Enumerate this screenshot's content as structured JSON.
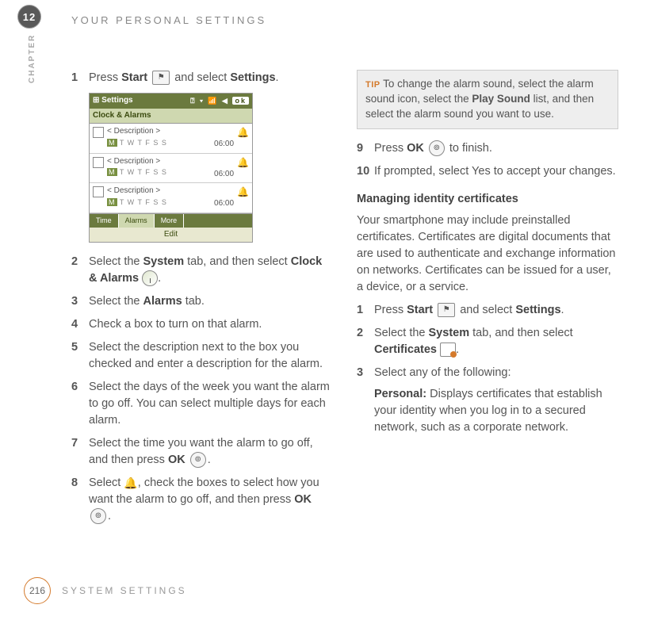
{
  "chapter_number": "12",
  "chapter_label": "CHAPTER",
  "section_title": "YOUR PERSONAL SETTINGS",
  "footer_page": "216",
  "footer_label": "SYSTEM SETTINGS",
  "left": {
    "step1_pre": "Press ",
    "step1_b1": "Start",
    "step1_mid": " and select ",
    "step1_b2": "Settings",
    "step1_post": ".",
    "screenshot": {
      "title": "Settings",
      "ok": "ok",
      "subbar": "Clock & Alarms",
      "desc": "< Description >",
      "days_on": "M",
      "days_rest": "T W T F S S",
      "time": "06:00",
      "tab_time": "Time",
      "tab_alarms": "Alarms",
      "tab_more": "More",
      "bottom": "Edit"
    },
    "step2_pre": "Select the ",
    "step2_b1": "System",
    "step2_mid": " tab, and then select ",
    "step2_b2": "Clock & Alarms",
    "step2_post": ".",
    "step3_pre": "Select the ",
    "step3_b": "Alarms",
    "step3_post": " tab.",
    "step4": "Check a box to turn on that alarm.",
    "step5": "Select the description next to the box you checked and enter a description for the alarm.",
    "step6": "Select the days of the week you want the alarm to go off. You can select multiple days for each alarm.",
    "step7_pre": "Select the time you want the alarm to go off, and then press ",
    "step7_b": "OK",
    "step7_post": ".",
    "step8_pre": "Select ",
    "step8_mid": ", check the boxes to select how you want the alarm to go off, and then press ",
    "step8_b": "OK",
    "step8_post": "."
  },
  "right": {
    "tip_label": "TIP",
    "tip_pre": " To change the alarm sound, select the alarm sound icon, select the ",
    "tip_b": "Play Sound",
    "tip_post": " list, and then select the alarm sound you want to use.",
    "step9_pre": "Press ",
    "step9_b": "OK",
    "step9_post": " to finish.",
    "step10": "If prompted, select Yes to accept your changes.",
    "subhead": "Managing identity certificates",
    "para": "Your smartphone may include preinstalled certificates. Certificates are digital documents that are used to authenticate and exchange information on networks. Certificates can be issued for a user, a device, or a service.",
    "c_step1_pre": "Press ",
    "c_step1_b1": "Start",
    "c_step1_mid": " and select ",
    "c_step1_b2": "Settings",
    "c_step1_post": ".",
    "c_step2_pre": "Select the ",
    "c_step2_b1": "System",
    "c_step2_mid": " tab, and then select ",
    "c_step2_b2": "Certificates",
    "c_step2_post": ".",
    "c_step3": "Select any of the following:",
    "c_personal_b": "Personal:",
    "c_personal_txt": " Displays certificates that establish your identity when you log in to a secured network, such as a corporate network."
  },
  "nums": {
    "n1": "1",
    "n2": "2",
    "n3": "3",
    "n4": "4",
    "n5": "5",
    "n6": "6",
    "n7": "7",
    "n8": "8",
    "n9": "9",
    "n10": "10"
  }
}
